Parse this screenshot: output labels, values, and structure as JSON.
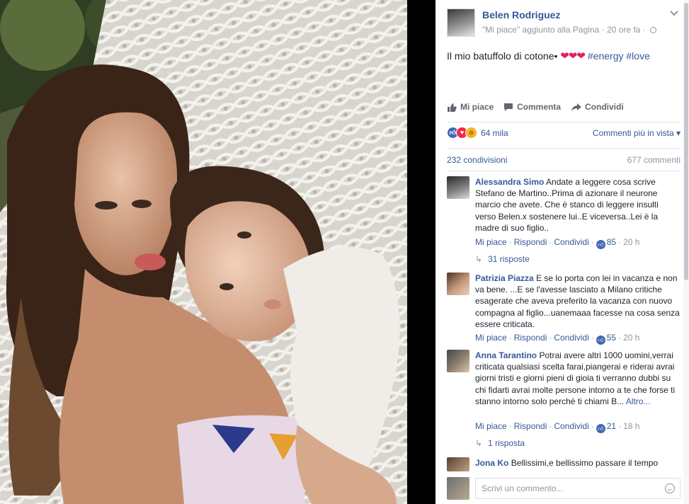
{
  "post": {
    "page_name": "Belen Rodriguez",
    "meta": "\"Mi piace\" aggiunto alla Pagina · 20 ore fa ·",
    "text": "Il mio batuffolo di cotone•",
    "hearts": "❤❤❤",
    "hashtag_1": "#energy",
    "hashtag_2": "#love"
  },
  "actions": {
    "like": "Mi piace",
    "comment": "Commenta",
    "share": "Condividi"
  },
  "reactions": {
    "count": "64 mila",
    "comments_view": "Commenti più in vista ▾",
    "icons": [
      "like-icon",
      "love-icon",
      "wow-icon"
    ]
  },
  "stats": {
    "shares": "232 condivisioni",
    "comments": "677 commenti"
  },
  "comments": [
    {
      "author": "Alessandra Simo",
      "text": "Andate a leggere cosa scrive Stefano de Martino..Prima di azionare il neurone marcio che avete. Che è stanco di leggere insulti verso Belen.x sostenere lui..E viceversa..Lei è la madre di suo figlio..",
      "like": "Mi piace",
      "reply": "Rispondi",
      "share": "Condividi",
      "likes": "85",
      "time": "20 h",
      "replies": "31 risposte"
    },
    {
      "author": "Patrizia Piazza",
      "text": "E se lo porta con lei in vacanza e non va bene. ...E se l'avesse lasciato a Milano critiche esagerate che aveva preferito la vacanza con nuovo compagna al figlio...uanemaaa facesse na cosa senza essere criticata.",
      "like": "Mi piace",
      "reply": "Rispondi",
      "share": "Condividi",
      "likes": "55",
      "time": "20 h"
    },
    {
      "author": "Anna Tarantino",
      "text": "Potrai avere altri 1000 uomini,verrai criticata qualsiasi scelta farai,piangerai e riderai avrai giorni tristi e giorni pieni di gioia ti verranno dubbi su chi fidarti avrai molte persone intorno a te che forse ti stanno intorno solo perché ti chiami B...",
      "more": "Altro...",
      "like": "Mi piace",
      "reply": "Rispondi",
      "share": "Condividi",
      "likes": "21",
      "time": "18 h",
      "replies": "1 risposta"
    },
    {
      "author": "Jona Ko",
      "text": "Bellissimi,e bellissimo passare il tempo"
    }
  ],
  "composer": {
    "placeholder": "Scrivi un commento..."
  },
  "colors": {
    "link": "#365899",
    "muted": "#90949c",
    "like_blue": "#4267b2",
    "love_red": "#f0284a"
  }
}
